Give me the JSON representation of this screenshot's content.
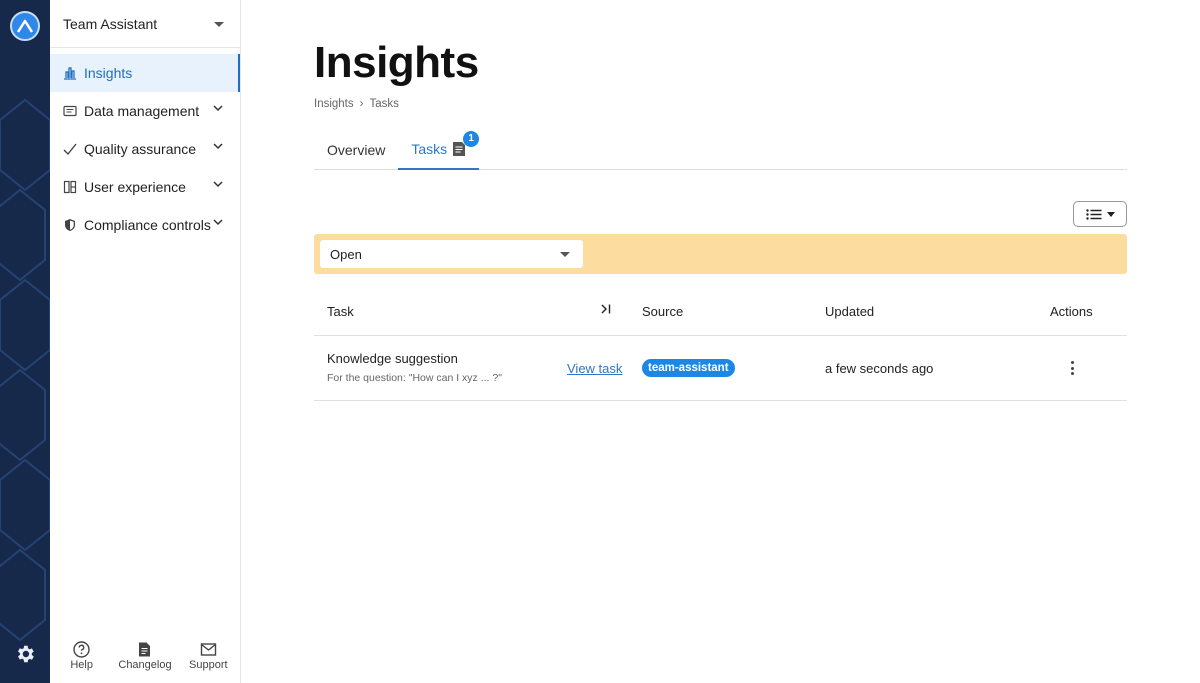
{
  "rail": {
    "logo_icon": "app-logo-icon",
    "settings_icon": "gear-icon"
  },
  "sidebar": {
    "workspace": "Team Assistant",
    "items": [
      {
        "label": "Insights",
        "icon": "bar-chart-icon",
        "active": true,
        "expandable": false
      },
      {
        "label": "Data management",
        "icon": "database-card-icon",
        "expandable": true
      },
      {
        "label": "Quality assurance",
        "icon": "checkmark-icon",
        "expandable": true
      },
      {
        "label": "User experience",
        "icon": "layout-icon",
        "expandable": true
      },
      {
        "label": "Compliance controls",
        "icon": "shield-icon",
        "expandable": true
      }
    ],
    "bottom": [
      {
        "label": "Help",
        "icon": "help-icon"
      },
      {
        "label": "Changelog",
        "icon": "document-icon"
      },
      {
        "label": "Support",
        "icon": "mail-icon"
      }
    ]
  },
  "page": {
    "title": "Insights",
    "breadcrumb": [
      "Insights",
      "Tasks"
    ],
    "tabs": [
      {
        "label": "Overview",
        "active": false
      },
      {
        "label": "Tasks",
        "active": true,
        "badge": "1"
      }
    ]
  },
  "filter": {
    "status": "Open"
  },
  "table": {
    "columns": [
      "Task",
      "Source",
      "Updated",
      "Actions"
    ],
    "rows": [
      {
        "task": "Knowledge suggestion",
        "question": "For the question: \"How can I xyz ... ?\"",
        "link": "View task",
        "source": "team-assistant",
        "updated": "a few seconds ago"
      }
    ]
  },
  "colors": {
    "accent": "#2d77c4",
    "rail": "#17294a",
    "filter_bg": "#fddc9f",
    "badge": "#1c88e5"
  }
}
